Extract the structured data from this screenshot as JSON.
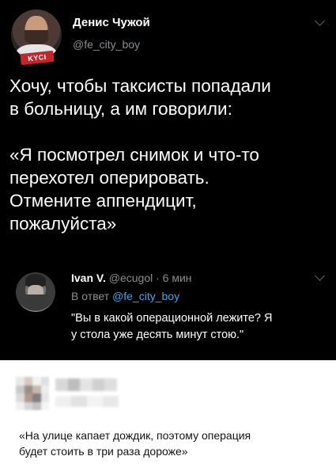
{
  "main_tweet": {
    "author_name": "Денис Чужой",
    "handle": "@fe_city_boy",
    "avatar_badge": "KYCI",
    "text": "Хочу, чтобы таксисты попадали\nв больницу, а им говорили:\n\n«Я посмотрел снимок и что-то\nперехотел оперировать.\nОтмените аппендицит,\nпожалуйста»"
  },
  "reply": {
    "author_name": "Ivan V.",
    "meta": "@ecugol · 6 мин",
    "reply_to_label": "В ответ",
    "reply_to_handle": "@fe_city_boy",
    "text": "\"Вы в какой операционной лежите? Я\nу стола уже десять минут стою.\""
  },
  "comment": {
    "text": "«На улице капает дождик, поэтому операция\nбудет стоить в три раза дороже»"
  },
  "colors": {
    "dark_bg": "#000000",
    "text_primary": "#ffffff",
    "text_secondary": "#8a8d91",
    "link": "#4aa3e8",
    "badge": "#c4262e",
    "light_bg": "#ffffff"
  }
}
